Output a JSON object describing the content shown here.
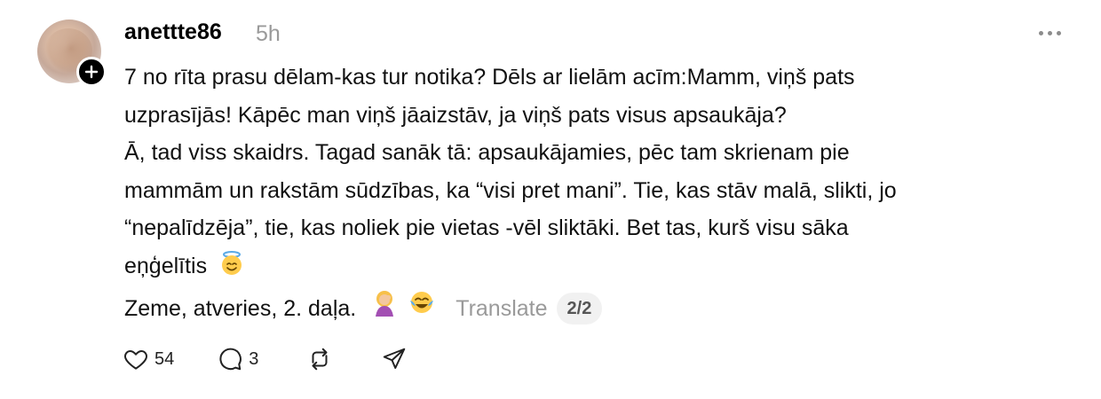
{
  "post": {
    "username": "anettte86",
    "time": "5h",
    "lines": [
      "7 no rīta prasu dēlam-kas tur notika? Dēls ar lielām acīm:Mamm, viņš pats",
      "uzprasījās! Kāpēc man viņš jāaizstāv, ja viņš pats visus apsaukāja?",
      "Ā, tad viss skaidrs. Tagad sanāk tā: apsaukājamies, pēc tam skrienam pie",
      "mammām un rakstām sūdzības, ka “visi pret mani”. Tie, kas stāv malā, slikti, jo",
      "“nepalīdzēja”, tie, kas noliek pie vietas -vēl sliktāki. Bet tas, kurš visu sāka",
      "eņģelītis"
    ],
    "last_line": "Zeme, atveries, 2. daļa.",
    "translate_label": "Translate",
    "page_indicator": "2/2",
    "emojis": [
      "smiling-face-with-halo",
      "woman-facepalming",
      "face-with-tears-of-joy"
    ]
  },
  "actions": {
    "likes": "54",
    "replies": "3"
  },
  "colors": {
    "text": "#111111",
    "muted": "#9a9a9a",
    "badge_bg": "#f1f1f1"
  }
}
